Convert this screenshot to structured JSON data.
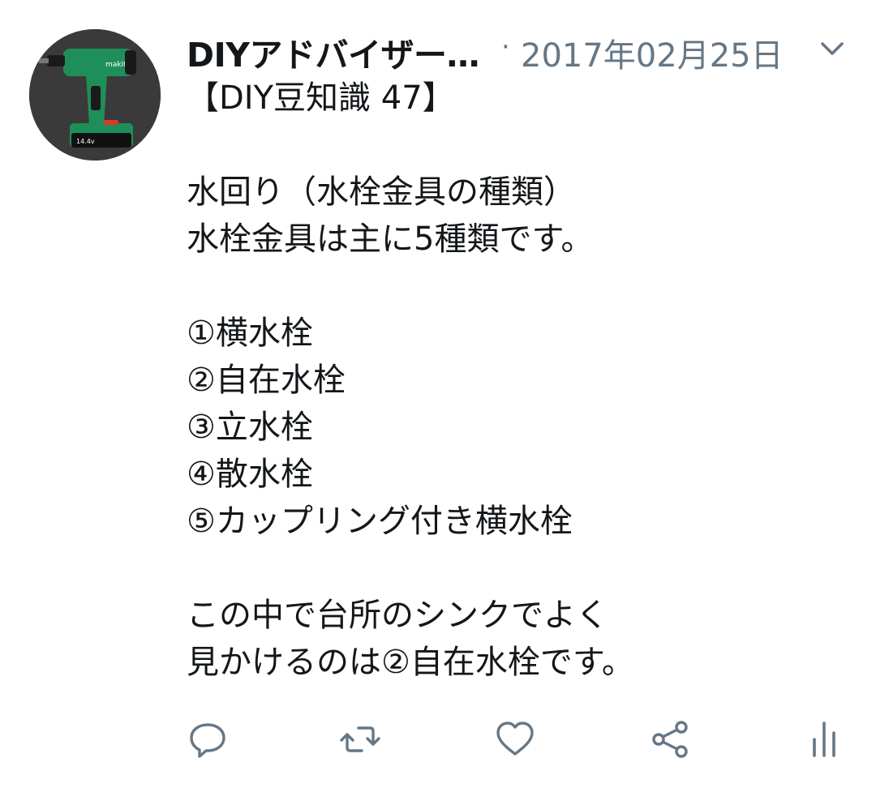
{
  "tweet": {
    "author_name": "DIYアドバイザー…",
    "separator": "·",
    "date": "2017年02月25日",
    "lines": [
      "【DIY豆知識 47】",
      "",
      "水回り（水栓金具の種類）",
      "水栓金具は主に5種類です。",
      "",
      "①横水栓",
      "②自在水栓",
      "③立水栓",
      "④散水栓",
      "⑤カップリング付き横水栓",
      "",
      "この中で台所のシンクでよく",
      "見かけるのは②自在水栓です。"
    ]
  },
  "icons": {
    "avatar": "impact-driver-photo",
    "menu": "chevron-down-icon",
    "reply": "reply-icon",
    "retweet": "retweet-icon",
    "like": "heart-icon",
    "share": "share-icon",
    "stats": "analytics-icon"
  },
  "colors": {
    "text": "#14171a",
    "secondary": "#657786",
    "icon": "#657786",
    "background": "#ffffff"
  }
}
